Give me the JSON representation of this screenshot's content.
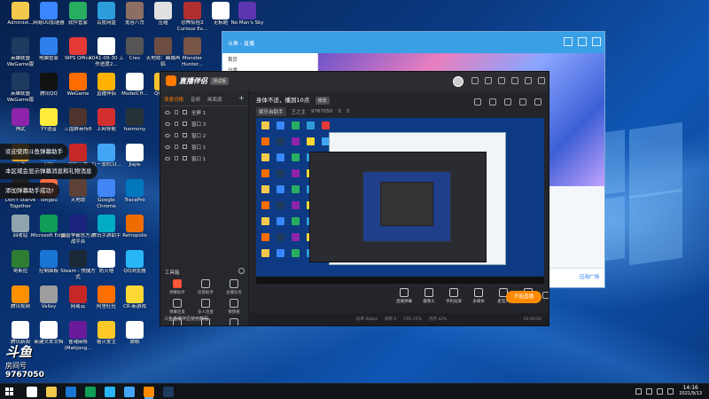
{
  "desktop": {
    "icons": [
      {
        "label": "Administ...",
        "color": "#f2c94c"
      },
      {
        "label": "网易UU加速器",
        "color": "#3a86ff"
      },
      {
        "label": "软件管家",
        "color": "#27ae60"
      },
      {
        "label": "百度网盘",
        "color": "#2d9cdb"
      },
      {
        "label": "鬼谷八荒",
        "color": "#8d6e63"
      },
      {
        "label": "压缩",
        "color": "#e0e0e0"
      },
      {
        "label": "恐怖惊险2 Curious Ex...",
        "color": "#b03030"
      },
      {
        "label": "无标题",
        "color": "#ffffff"
      },
      {
        "label": "No Man's Sky",
        "color": "#5e35b1"
      },
      {
        "label": "英雄联盟 WeGame版",
        "color": "#1e3a5f"
      },
      {
        "label": "电脑管家",
        "color": "#2f80ed"
      },
      {
        "label": "WPS Office",
        "color": "#e53935"
      },
      {
        "label": "X041-09-30 工作进度2...",
        "color": "#ffffff"
      },
      {
        "label": "Crev",
        "color": "#555555"
      },
      {
        "label": "天地劫：幽城再临",
        "color": "#6d4c41"
      },
      {
        "label": "Monster Hunter...",
        "color": "#795548"
      },
      {
        "label": "英雄联盟 WeGame版",
        "color": "#1e3a5f"
      },
      {
        "label": "腾讯QQ",
        "color": "#111111"
      },
      {
        "label": "WeGame",
        "color": "#ff6d00"
      },
      {
        "label": "直播伴侣",
        "color": "#ffb300"
      },
      {
        "label": "ModelCH...",
        "color": "#ffffff"
      },
      {
        "label": "QQ音乐",
        "color": "#fbc02d"
      },
      {
        "label": "神武",
        "color": "#8e24aa"
      },
      {
        "label": "YY语音",
        "color": "#ffeb3b"
      },
      {
        "label": "三国群英传8",
        "color": "#4e342e"
      },
      {
        "label": "上网导航",
        "color": "#d32f2f"
      },
      {
        "label": "harmony",
        "color": "#263238"
      },
      {
        "label": "工作",
        "color": "#f9a825"
      },
      {
        "label": "网络",
        "color": "#1565c0"
      },
      {
        "label": "爆枪英雄",
        "color": "#c62828"
      },
      {
        "label": "钉一发ECU...",
        "color": "#42a5f5"
      },
      {
        "label": "Jiajie",
        "color": "#ffffff"
      },
      {
        "label": "Don't Starve Together",
        "color": "#212121"
      },
      {
        "label": "Tongbu",
        "color": "#ff7043"
      },
      {
        "label": "天地劫",
        "color": "#5d4037"
      },
      {
        "label": "Google Chrome",
        "color": "#4285f4"
      },
      {
        "label": "TracePro",
        "color": "#0277bd"
      },
      {
        "label": "回收站",
        "color": "#90a4ae"
      },
      {
        "label": "Microsoft Edge",
        "color": "#0f9d58"
      },
      {
        "label": "魔兽争霸官方对战平台",
        "color": "#1a237e"
      },
      {
        "label": "腾讯手游助手",
        "color": "#00acc1"
      },
      {
        "label": "Retropolis",
        "color": "#ef6c00"
      },
      {
        "label": "哥斯拉",
        "color": "#2e7d32"
      },
      {
        "label": "控制面板",
        "color": "#1976d2"
      },
      {
        "label": "Steam - 快捷方式",
        "color": "#1b2838"
      },
      {
        "label": "防火墙",
        "color": "#ffffff"
      },
      {
        "label": "QQ浏览器",
        "color": "#29b6f6"
      },
      {
        "label": "腾讯视频",
        "color": "#ff9100"
      },
      {
        "label": "Valley",
        "color": "#9e9e9e"
      },
      {
        "label": "网易云",
        "color": "#c62828"
      },
      {
        "label": "阿里旺旺",
        "color": "#ff6f00"
      },
      {
        "label": "CR-新游戏",
        "color": "#fdd835"
      },
      {
        "label": "腾讯新闻",
        "color": "#ffffff"
      },
      {
        "label": "新建文本文档",
        "color": "#ffffff"
      },
      {
        "label": "雀魂麻将 (Mahjong...",
        "color": "#6a1b9a"
      },
      {
        "label": "格火爱主",
        "color": "#ffca28"
      },
      {
        "label": "旅眼",
        "color": "#ffffff"
      }
    ]
  },
  "toasts": [
    "欢迎使用斗鱼弹幕助手",
    "本区域会显示弹幕消息和礼物消息",
    "添加弹幕助手成功!"
  ],
  "room": {
    "logo": "斗鱼",
    "label": "房间号",
    "number": "9767050"
  },
  "bg_window": {
    "title": "斗鱼 - 直播",
    "side_rows": [
      "首页",
      "分类",
      "娱乐",
      "游戏"
    ],
    "bottom_button": "应用广场"
  },
  "app": {
    "brand": "直播伴侣",
    "version": "测试版",
    "tabs": {
      "scenes": "场景切换",
      "sound": "音频",
      "canvas": "画面源"
    },
    "scenes": [
      "全屏 1",
      "窗口 3",
      "窗口 2",
      "窗口 1",
      "窗口 1"
    ],
    "tools_title": "工具箱",
    "tools": [
      {
        "label": "弹幕助手",
        "hot": true
      },
      {
        "label": "房管助手",
        "hot": false
      },
      {
        "label": "主播任务",
        "hot": false
      },
      {
        "label": "弹幕连麦",
        "hot": false
      },
      {
        "label": "多人连麦",
        "hot": false
      },
      {
        "label": "猜猜看",
        "hot": false
      },
      {
        "label": "虚拟形象",
        "hot": false
      },
      {
        "label": "弹幕墙",
        "hot": false
      },
      {
        "label": "歌词显示",
        "hot": false
      }
    ],
    "warning": "斗鱼直播伴侣使用教程",
    "info": {
      "title": "身体不适，播到10点",
      "tag": "修改",
      "chip": "娱乐自助手",
      "owner": "王之主",
      "room": "9767050",
      "fans": "0",
      "watch": "0"
    },
    "toolbar": [
      "直播弹幕",
      "摄像头",
      "手机投屏",
      "多媒体",
      "麦克风",
      "扬声器"
    ],
    "start_button": "开始直播",
    "status": {
      "bitrate": "码率 0kbps",
      "fps": "帧率 0",
      "cpu": "CPU 25%",
      "mem": "内存 42%",
      "time": "00:00:00"
    }
  },
  "taskbar": {
    "time": "14:16",
    "date": "2021/9/13"
  }
}
